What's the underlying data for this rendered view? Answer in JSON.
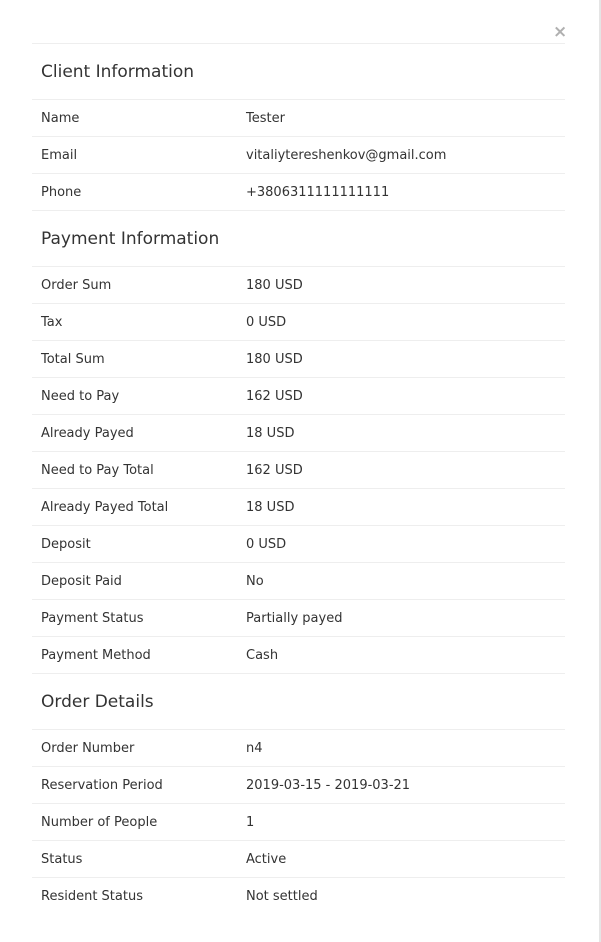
{
  "close_label": "×",
  "sections": {
    "client": {
      "title": "Client Information",
      "rows": [
        {
          "label": "Name",
          "value": "Tester"
        },
        {
          "label": "Email",
          "value": "vitaliytereshenkov@gmail.com"
        },
        {
          "label": "Phone",
          "value": "+3806311111111111"
        }
      ]
    },
    "payment": {
      "title": "Payment Information",
      "rows": [
        {
          "label": "Order Sum",
          "value": "180 USD"
        },
        {
          "label": "Tax",
          "value": "0 USD"
        },
        {
          "label": "Total Sum",
          "value": "180 USD"
        },
        {
          "label": "Need to Pay",
          "value": "162 USD"
        },
        {
          "label": "Already Payed",
          "value": "18 USD"
        },
        {
          "label": "Need to Pay Total",
          "value": "162 USD"
        },
        {
          "label": "Already Payed Total",
          "value": "18 USD"
        },
        {
          "label": "Deposit",
          "value": "0 USD"
        },
        {
          "label": "Deposit Paid",
          "value": "No"
        },
        {
          "label": "Payment Status",
          "value": "Partially payed"
        },
        {
          "label": "Payment Method",
          "value": "Cash"
        }
      ]
    },
    "order": {
      "title": "Order Details",
      "rows": [
        {
          "label": "Order Number",
          "value": "n4"
        },
        {
          "label": "Reservation Period",
          "value": "2019-03-15 - 2019-03-21"
        },
        {
          "label": "Number of People",
          "value": "1"
        },
        {
          "label": "Status",
          "value": "Active"
        },
        {
          "label": "Resident Status",
          "value": "Not settled"
        }
      ]
    }
  }
}
